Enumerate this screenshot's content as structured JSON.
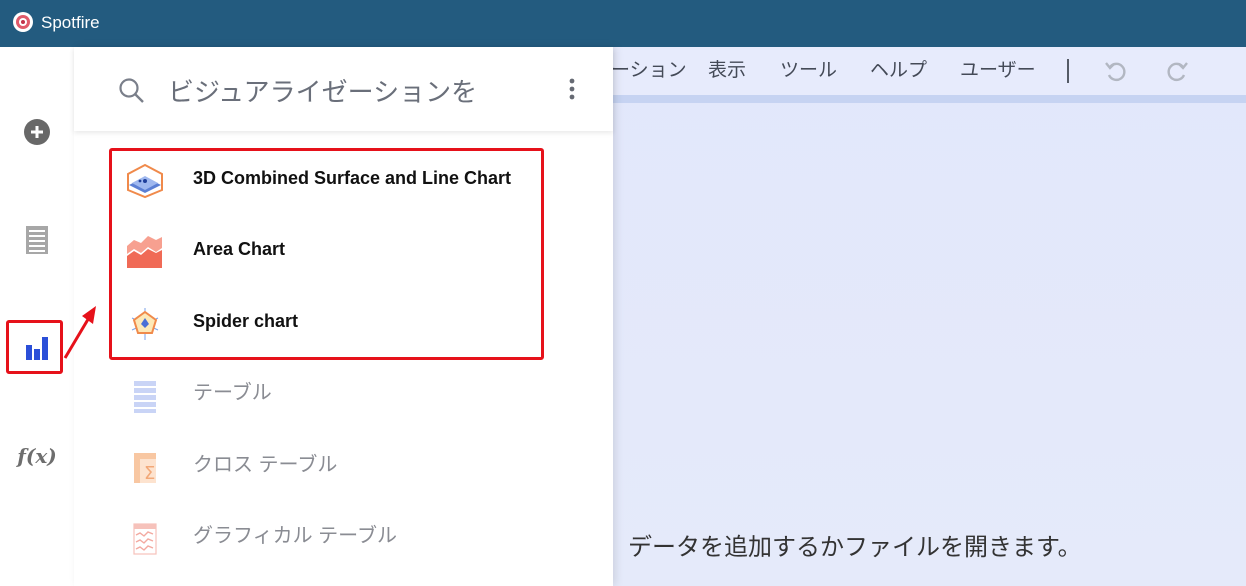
{
  "titlebar": {
    "title": "Spotfire"
  },
  "menubar": {
    "items": [
      "ーション",
      "表示",
      "ツール",
      "ヘルプ",
      "ユーザー"
    ]
  },
  "flyout": {
    "search_placeholder": "ビジュアライゼーションを",
    "recent": [
      {
        "label": "3D Combined Surface and Line Chart",
        "icon": "3d-surface-icon"
      },
      {
        "label": "Area Chart",
        "icon": "area-chart-icon"
      },
      {
        "label": "Spider chart",
        "icon": "spider-chart-icon"
      }
    ],
    "list": [
      {
        "label": "テーブル",
        "icon": "table-icon"
      },
      {
        "label": "クロス テーブル",
        "icon": "cross-table-icon"
      },
      {
        "label": "グラフィカル テーブル",
        "icon": "graphical-table-icon"
      }
    ]
  },
  "main": {
    "empty_message": "、データを追加するかファイルを開きます。"
  },
  "sidebar": {
    "icons": [
      "add-icon",
      "data-table-icon",
      "visualization-icon",
      "function-icon"
    ],
    "fx_label": "f(x)"
  },
  "colors": {
    "titlebar": "#235b7f",
    "highlight": "#e6111a",
    "accent": "#2b4fd8"
  }
}
